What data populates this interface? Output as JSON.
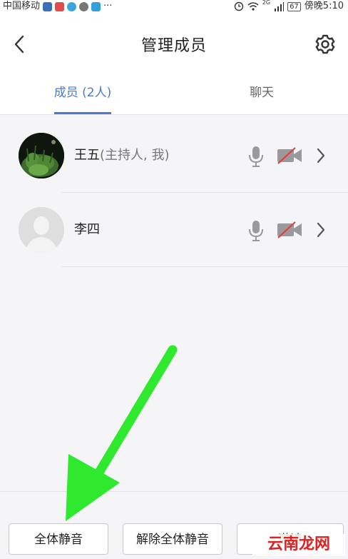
{
  "status_bar": {
    "carrier": "中国移动",
    "dots": "···",
    "network_label": "2G",
    "battery": "67",
    "time": "傍晚5:10"
  },
  "header": {
    "title": "管理成员"
  },
  "tabs": [
    {
      "label": "成员 (2人)",
      "active": true
    },
    {
      "label": "聊天",
      "active": false
    }
  ],
  "members": [
    {
      "name": "王五",
      "role": "(主持人, 我)",
      "avatar": "photo-avatar"
    },
    {
      "name": "李四",
      "role": "",
      "avatar": "default-avatar"
    }
  ],
  "bottom_buttons": {
    "mute_all": "全体静音",
    "unmute_all": "解除全体静音",
    "third": "邀请"
  },
  "watermark": {
    "text": "云南龙网"
  },
  "colors": {
    "accent": "#4a7bd0",
    "muted_red": "#e0403a",
    "arrow_green": "#2ee92e"
  }
}
